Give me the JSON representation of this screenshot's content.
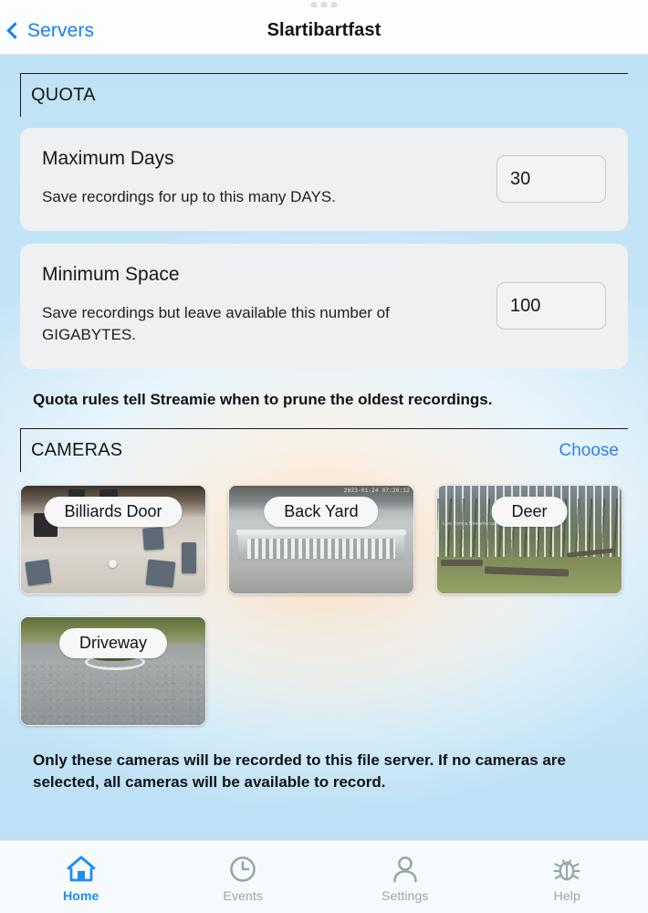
{
  "statusbar": {
    "dots": 3
  },
  "navbar": {
    "back_label": "Servers",
    "back_icon": "chevron-left-icon",
    "title": "Slartibartfast"
  },
  "sections": {
    "quota": {
      "header": "QUOTA",
      "cards": [
        {
          "title": "Maximum Days",
          "description": "Save recordings for up to this many DAYS.",
          "value": "30",
          "placeholder": "30"
        },
        {
          "title": "Minimum Space",
          "description": "Save recordings but leave available this number of GIGABYTES.",
          "value": "100",
          "placeholder": "100"
        }
      ],
      "note": "Quota rules tell Streamie when to prune the oldest recordings."
    },
    "cameras": {
      "header": "CAMERAS",
      "action_label": "Choose",
      "items": [
        {
          "label": "Billiards Door",
          "stamp": "",
          "watermark": ""
        },
        {
          "label": "Back Yard",
          "stamp": "2023-01-24 07:20:12",
          "watermark": ""
        },
        {
          "label": "Deer",
          "stamp": "",
          "watermark": "Live from a\nStreamie camera"
        },
        {
          "label": "Driveway",
          "stamp": "",
          "watermark": ""
        }
      ],
      "note": "Only these cameras will be recorded to this file server. If no cameras are selected, all cameras will be available to record."
    }
  },
  "tabbar": {
    "tabs": [
      {
        "label": "Home",
        "icon": "home-icon",
        "active": true
      },
      {
        "label": "Events",
        "icon": "clock-icon",
        "active": false
      },
      {
        "label": "Settings",
        "icon": "person-icon",
        "active": false
      },
      {
        "label": "Help",
        "icon": "bug-icon",
        "active": false
      }
    ]
  },
  "colors": {
    "accent": "#1a7ef2",
    "tab_active": "#1f8cf5",
    "tab_inactive": "#9aa6ab",
    "background": "#bfe2f5",
    "card": "#eff0f2",
    "text": "#15181b"
  }
}
